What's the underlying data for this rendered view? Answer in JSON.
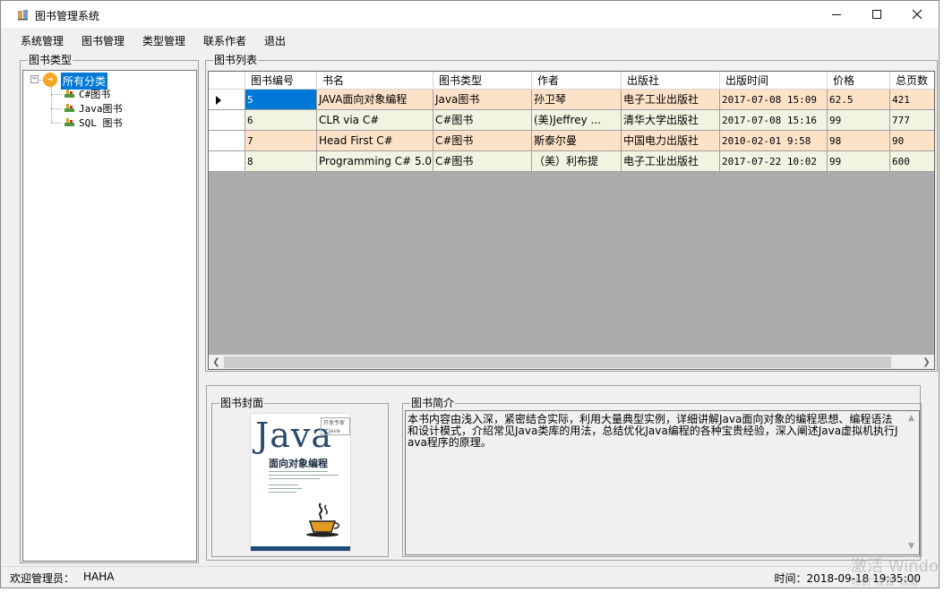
{
  "window": {
    "title": "图书管理系统"
  },
  "menu": [
    "系统管理",
    "图书管理",
    "类型管理",
    "联系作者",
    "退出"
  ],
  "groups": {
    "types": "图书类型",
    "list": "图书列表",
    "cover": "图书封面",
    "intro": "图书简介"
  },
  "tree": {
    "root": "所有分类",
    "children": [
      "C#图书",
      "Java图书",
      "SQL 图书"
    ]
  },
  "grid": {
    "columns": [
      "图书编号",
      "书名",
      "图书类型",
      "作者",
      "出版社",
      "出版时间",
      "价格",
      "总页数"
    ],
    "rows": [
      [
        "5",
        "JAVA面向对象编程",
        "Java图书",
        "孙卫琴",
        "电子工业出版社",
        "2017-07-08 15:09",
        "62.5",
        "421"
      ],
      [
        "6",
        "CLR via C#",
        "C#图书",
        "(美)Jeffrey ...",
        "清华大学出版社",
        "2017-07-08 15:16",
        "99",
        "777"
      ],
      [
        "7",
        "Head First C#",
        "C#图书",
        "斯泰尔曼",
        "中国电力出版社",
        "2010-02-01 9:58",
        "98",
        "90"
      ],
      [
        "8",
        "Programming C# 5.0",
        "C#图书",
        "（美）利布提",
        "电子工业出版社",
        "2017-07-22 10:02",
        "99",
        "600"
      ]
    ],
    "row_colors": [
      "#fde2c8",
      "#f1f4e0",
      "#fde2c8",
      "#f1f4e0"
    ],
    "selected_row": 0
  },
  "cover": {
    "title_text": "Java",
    "subtitle_text": "面向对象编程",
    "tag_text": "开发专家之Java"
  },
  "intro_text": "本书内容由浅入深，紧密结合实际，利用大量典型实例，详细讲解Java面向对象的编程思想、编程语法和设计模式，介绍常见Java类库的用法，总结优化Java编程的各种宝贵经验，深入阐述Java虚拟机执行Java程序的原理。",
  "status": {
    "welcome": "欢迎管理员：",
    "user": "HAHA",
    "time": "时间：2018-09-18 19:35:00"
  },
  "watermark": {
    "line1": "激活 Windo",
    "line2": "转到\"设置\"以激"
  }
}
